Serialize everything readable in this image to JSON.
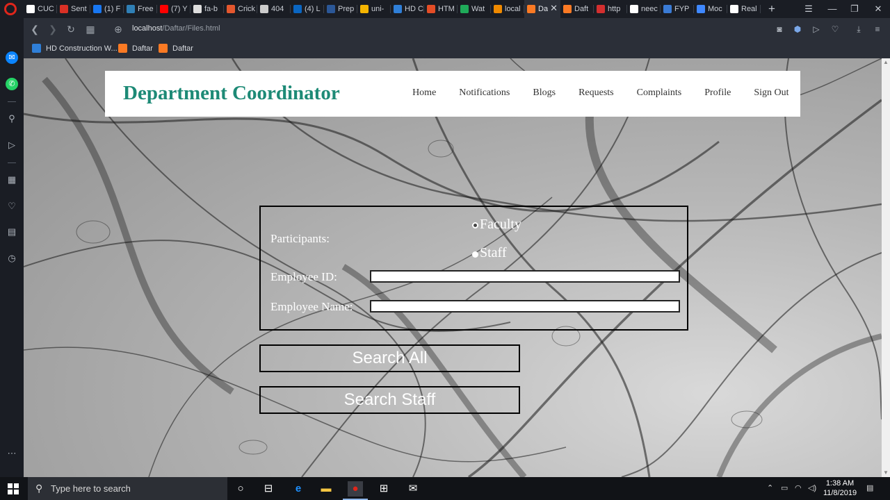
{
  "browser": {
    "tabs": [
      {
        "label": "CUC",
        "icon": "cuc-icon",
        "color": "#ffffff"
      },
      {
        "label": "Sent",
        "icon": "gmail-icon",
        "color": "#d93025"
      },
      {
        "label": "(1) F",
        "icon": "facebook-icon",
        "color": "#1877f2"
      },
      {
        "label": "Free",
        "icon": "freecodecamp-icon",
        "color": "#2f7fb5"
      },
      {
        "label": "(7) Y",
        "icon": "youtube-icon",
        "color": "#ff0000"
      },
      {
        "label": "fa-b",
        "icon": "flag-icon",
        "color": "#dddddd"
      },
      {
        "label": "Crick",
        "icon": "cricket-icon",
        "color": "#e4572e"
      },
      {
        "label": "404",
        "icon": "document-icon",
        "color": "#cccccc"
      },
      {
        "label": "(4) L",
        "icon": "linkedin-icon",
        "color": "#0a66c2"
      },
      {
        "label": "Prep",
        "icon": "d-icon",
        "color": "#2b5797"
      },
      {
        "label": "uni-",
        "icon": "candle-icon",
        "color": "#f4b400"
      },
      {
        "label": "HD C",
        "icon": "hd-icon",
        "color": "#2f7fd8"
      },
      {
        "label": "HTM",
        "icon": "html-icon",
        "color": "#e44d26"
      },
      {
        "label": "Wat",
        "icon": "v-icon",
        "color": "#1faa59"
      },
      {
        "label": "local",
        "icon": "vlc-icon",
        "color": "#f08a00"
      },
      {
        "label": "Da",
        "icon": "xampp-icon",
        "color": "#fb7a24",
        "active": true
      },
      {
        "label": "Daft",
        "icon": "xampp-icon",
        "color": "#fb7a24"
      },
      {
        "label": "http",
        "icon": "shield-icon",
        "color": "#d32f2f"
      },
      {
        "label": "neec",
        "icon": "google-icon",
        "color": "#ffffff"
      },
      {
        "label": "FYP",
        "icon": "f-icon",
        "color": "#3a7bd5"
      },
      {
        "label": "Moc",
        "icon": "m-icon",
        "color": "#3f88ff"
      },
      {
        "label": "Real",
        "icon": "google-icon",
        "color": "#ffffff"
      }
    ],
    "close_glyph": "✕",
    "new_tab_glyph": "+",
    "url_host": "localhost",
    "url_path": "/Daftar/Files.html",
    "bookmarks": [
      {
        "label": "HD Construction W...",
        "icon": "hd-icon",
        "color": "#2f7fd8"
      },
      {
        "label": "Daftar",
        "icon": "xampp-icon",
        "color": "#fb7a24"
      },
      {
        "label": "Daftar",
        "icon": "xampp-icon",
        "color": "#fb7a24"
      }
    ]
  },
  "header": {
    "title": "Department Coordinator",
    "nav": [
      "Home",
      "Notifications",
      "Blogs",
      "Requests",
      "Complaints",
      "Profile",
      "Sign Out"
    ],
    "accent_color": "#1d8a76"
  },
  "form": {
    "participants_label": "Participants:",
    "options": [
      {
        "label": "Faculty",
        "selected": false
      },
      {
        "label": "Staff",
        "selected": true
      }
    ],
    "employee_id_label": "Employee ID:",
    "employee_id_value": "",
    "employee_name_label": "Employee Name:",
    "employee_name_value": "",
    "search_all_label": "Search All",
    "search_staff_label": "Search Staff"
  },
  "taskbar": {
    "search_placeholder": "Type here to search",
    "time": "1:38 AM",
    "date": "11/8/2019"
  }
}
